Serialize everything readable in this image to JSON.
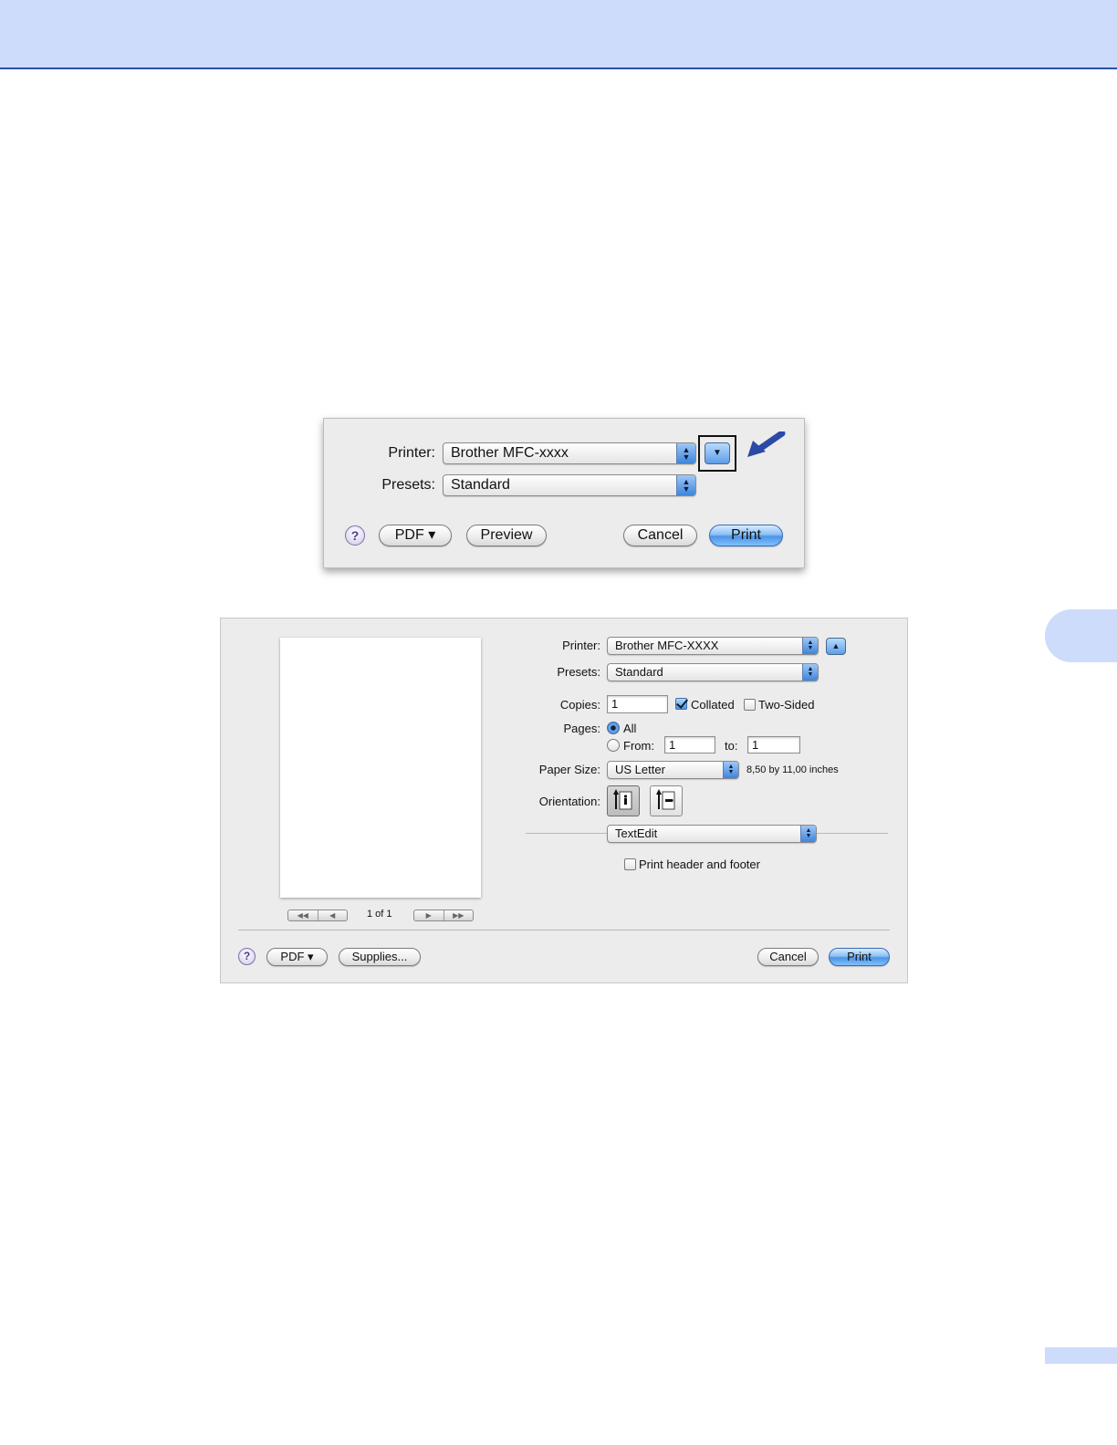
{
  "page": {
    "header_band_color": "#cddcfb",
    "rule_color": "#2a4fa6"
  },
  "dialog1": {
    "printer_label": "Printer:",
    "printer_value": "Brother MFC-xxxx",
    "presets_label": "Presets:",
    "presets_value": "Standard",
    "disclosure_icon": "triangle-down-icon",
    "help_glyph": "?",
    "pdf_label": "PDF ▾",
    "preview_label": "Preview",
    "cancel_label": "Cancel",
    "print_label": "Print"
  },
  "dialog2": {
    "printer_label": "Printer:",
    "printer_value": "Brother MFC-XXXX",
    "presets_label": "Presets:",
    "presets_value": "Standard",
    "copies_label": "Copies:",
    "copies_value": "1",
    "collated_label": "Collated",
    "collated_checked": true,
    "two_sided_label": "Two-Sided",
    "two_sided_checked": false,
    "pages_label": "Pages:",
    "all_label": "All",
    "from_label": "From:",
    "from_value": "1",
    "to_label": "to:",
    "to_value": "1",
    "paper_size_label": "Paper Size:",
    "paper_size_value": "US Letter",
    "paper_size_dims": "8,50 by 11,00 inches",
    "orientation_label": "Orientation:",
    "app_popup_value": "TextEdit",
    "header_footer_label": "Print header and footer",
    "header_footer_checked": false,
    "page_counter": "1 of 1",
    "help_glyph": "?",
    "pdf_label": "PDF ▾",
    "supplies_label": "Supplies...",
    "cancel_label": "Cancel",
    "print_label": "Print"
  }
}
